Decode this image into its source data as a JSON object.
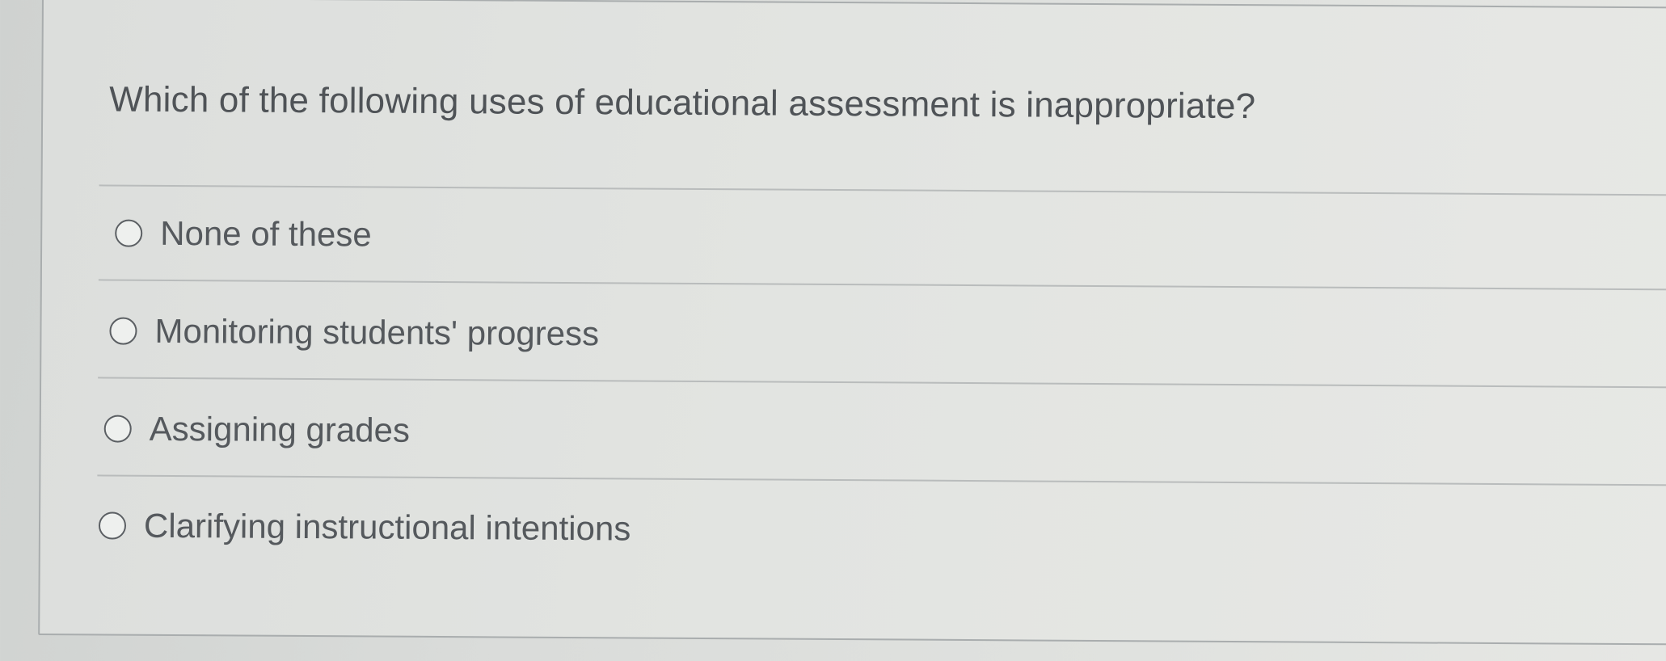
{
  "question": {
    "text": "Which of the following uses of educational assessment is inappropriate?"
  },
  "options": [
    {
      "label": "None of these",
      "selected": false
    },
    {
      "label": "Monitoring students' progress",
      "selected": false
    },
    {
      "label": "Assigning grades",
      "selected": false
    },
    {
      "label": "Clarifying instructional intentions",
      "selected": false
    }
  ]
}
